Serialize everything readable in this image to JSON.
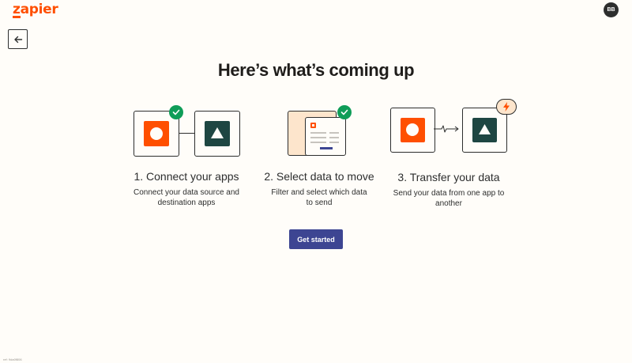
{
  "brand": {
    "logo_text": "zapier",
    "accent": "#ff4f00"
  },
  "user": {
    "initials": "BB"
  },
  "nav": {
    "back_icon": "arrow-left-icon"
  },
  "heading": "Here’s what’s coming up",
  "steps": [
    {
      "title": "1. Connect your apps",
      "desc_line1": "Connect your data source and",
      "desc_line2": "destination apps",
      "completed": true
    },
    {
      "title": "2. Select data to move",
      "desc_line1": "Filter and select which data",
      "desc_line2": "to send",
      "completed": true
    },
    {
      "title": "3. Transfer your data",
      "desc_line1": "Send your data from one app to",
      "desc_line2": "another",
      "completed": false
    }
  ],
  "cta": {
    "label": "Get started",
    "color": "#3d4592"
  },
  "footer": {
    "id_text": "ref: 9da0f806"
  },
  "colors": {
    "source_app": "#ff4f00",
    "destination_app": "#1e4642",
    "check": "#0f9d58",
    "doc_fill": "#fde5cc",
    "data_bar": "#3d4592"
  }
}
